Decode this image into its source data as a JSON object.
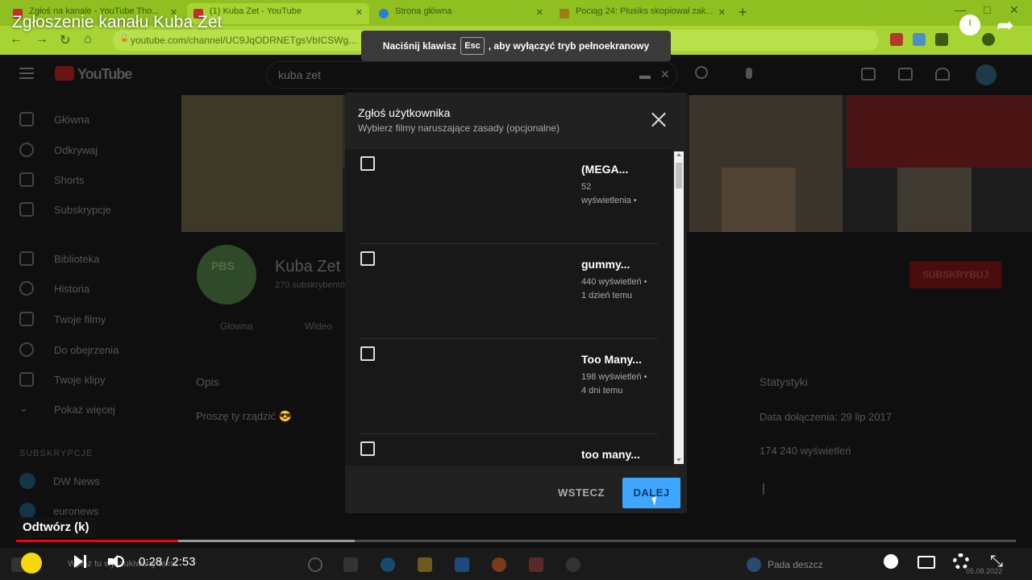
{
  "browser": {
    "tabs": [
      {
        "label": "Zgłoś na kanale - YouTube Tho...",
        "color": "#c4302b"
      },
      {
        "label": "(1) Kuba Zet - YouTube",
        "color": "#c4302b"
      },
      {
        "label": "Strona główna",
        "color": "#2a7fd6"
      },
      {
        "label": "Pociąg 24: Plusiks skopiował zak...",
        "color": "#9e7c18"
      }
    ],
    "url": "youtube.com/channel/UC9JqODRNETgsVbICSWg...",
    "fullscreen_toast": {
      "before": "Naciśnij klawisz",
      "key": "Esc",
      "after": ", aby wyłączyć tryb pełnoekranowy"
    }
  },
  "video": {
    "title": "Zgłoszenie kanału Kuba Zet",
    "play_tooltip": "Odtwórz (k)",
    "current_time": "0:28",
    "time_separator": "/",
    "duration": "2:53",
    "progress_played": 0.162,
    "progress_buffered": 0.339
  },
  "youtube": {
    "logo_text": "YouTube",
    "search_value": "kuba zet",
    "sidebar": {
      "items": [
        {
          "label": "Główna",
          "icon": "home-icon"
        },
        {
          "label": "Odkrywaj",
          "icon": "compass-icon"
        },
        {
          "label": "Shorts",
          "icon": "shorts-icon"
        },
        {
          "label": "Subskrypcje",
          "icon": "subscriptions-icon"
        },
        {
          "label": "Biblioteka",
          "icon": "library-icon"
        },
        {
          "label": "Historia",
          "icon": "history-icon"
        },
        {
          "label": "Twoje filmy",
          "icon": "your-videos-icon"
        },
        {
          "label": "Do obejrzenia",
          "icon": "watch-later-icon"
        },
        {
          "label": "Twoje klipy",
          "icon": "clips-icon"
        },
        {
          "label": "Pokaż więcej",
          "icon": "chevron-down-icon"
        }
      ],
      "subs_heading": "SUBSKRYPCJE",
      "subscriptions": [
        {
          "label": "DW News"
        },
        {
          "label": "euronews"
        }
      ]
    },
    "channel": {
      "name": "Kuba Zet",
      "subscribers": "270 subskrybentów",
      "avatar_text": "PBS",
      "subscribe_label": "SUBSKRYBUJ",
      "tabs": [
        "Główna",
        "Wideo"
      ]
    },
    "about": {
      "description_heading": "Opis",
      "description": "Proszę ty rządzić 😎",
      "stats_heading": "Statystyki",
      "joined": "Data dołączenia: 29 lip 2017",
      "views": "174 240 wyświetleń"
    }
  },
  "modal": {
    "title": "Zgłoś użytkownika",
    "subtitle": "Wybierz filmy naruszające zasady (opcjonalne)",
    "videos": [
      {
        "title": "(MEGA...",
        "meta_line1": "52",
        "meta_line2": "wyświetlenia •"
      },
      {
        "title": "gummy...",
        "meta_line1": "440 wyświetleń •",
        "meta_line2": "1 dzień temu"
      },
      {
        "title": "Too Many...",
        "meta_line1": "198 wyświetleń •",
        "meta_line2": "4 dni temu"
      },
      {
        "title": "too many...",
        "meta_line1": "",
        "meta_line2": ""
      }
    ],
    "back_label": "WSTECZ",
    "next_label": "DALEJ"
  },
  "taskbar": {
    "search_placeholder": "Wpisz tu wyszukiwany tekst",
    "weather": "Pada deszcz",
    "date": "05.08.2022"
  }
}
